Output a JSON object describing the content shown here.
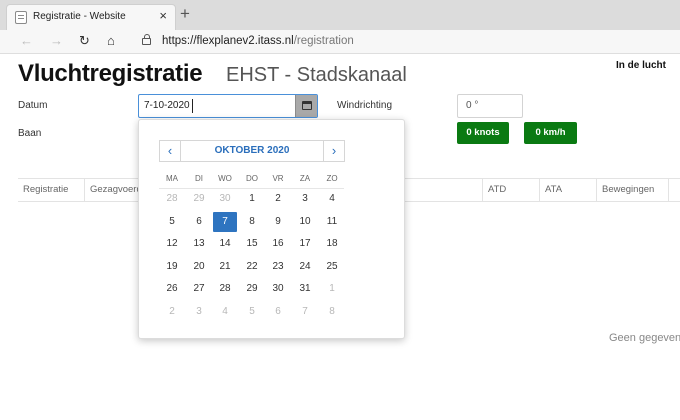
{
  "browser": {
    "tab_title": "Registratie - Website",
    "url_host": "https://flexplanev2.itass.nl",
    "url_path": "/registration"
  },
  "header": {
    "title": "Vluchtregistratie",
    "subtitle": "EHST - Stadskanaal",
    "status": "In de lucht"
  },
  "form": {
    "date_label": "Datum",
    "date_value": "7-10-2020",
    "runway_label": "Baan",
    "wind_label": "Windrichting",
    "wind_value": "0 °",
    "badges": [
      "0 knots",
      "0 km/h"
    ]
  },
  "table": {
    "columns": [
      "Registratie",
      "Gezagvoerder",
      "ATD",
      "ATA",
      "Bewegingen"
    ],
    "empty_text": "Geen gegeven"
  },
  "datepicker": {
    "month_label": "OKTOBER 2020",
    "prev_label": "‹",
    "next_label": "›",
    "weekdays": [
      "MA",
      "DI",
      "WO",
      "DO",
      "VR",
      "ZA",
      "ZO"
    ],
    "weeks": [
      [
        {
          "d": "28",
          "m": true
        },
        {
          "d": "29",
          "m": true
        },
        {
          "d": "30",
          "m": true
        },
        {
          "d": "1"
        },
        {
          "d": "2"
        },
        {
          "d": "3"
        },
        {
          "d": "4"
        }
      ],
      [
        {
          "d": "5"
        },
        {
          "d": "6"
        },
        {
          "d": "7",
          "s": true
        },
        {
          "d": "8"
        },
        {
          "d": "9"
        },
        {
          "d": "10"
        },
        {
          "d": "11"
        }
      ],
      [
        {
          "d": "12"
        },
        {
          "d": "13"
        },
        {
          "d": "14"
        },
        {
          "d": "15"
        },
        {
          "d": "16"
        },
        {
          "d": "17"
        },
        {
          "d": "18"
        }
      ],
      [
        {
          "d": "19"
        },
        {
          "d": "20"
        },
        {
          "d": "21"
        },
        {
          "d": "22"
        },
        {
          "d": "23"
        },
        {
          "d": "24"
        },
        {
          "d": "25"
        }
      ],
      [
        {
          "d": "26"
        },
        {
          "d": "27"
        },
        {
          "d": "28"
        },
        {
          "d": "29"
        },
        {
          "d": "30"
        },
        {
          "d": "31"
        },
        {
          "d": "1",
          "m": true
        }
      ],
      [
        {
          "d": "2",
          "m": true
        },
        {
          "d": "3",
          "m": true
        },
        {
          "d": "4",
          "m": true
        },
        {
          "d": "5",
          "m": true
        },
        {
          "d": "6",
          "m": true
        },
        {
          "d": "7",
          "m": true
        },
        {
          "d": "8",
          "m": true
        }
      ]
    ]
  },
  "colors": {
    "accent": "#2e74c0",
    "badge_green": "#0a7a12"
  }
}
